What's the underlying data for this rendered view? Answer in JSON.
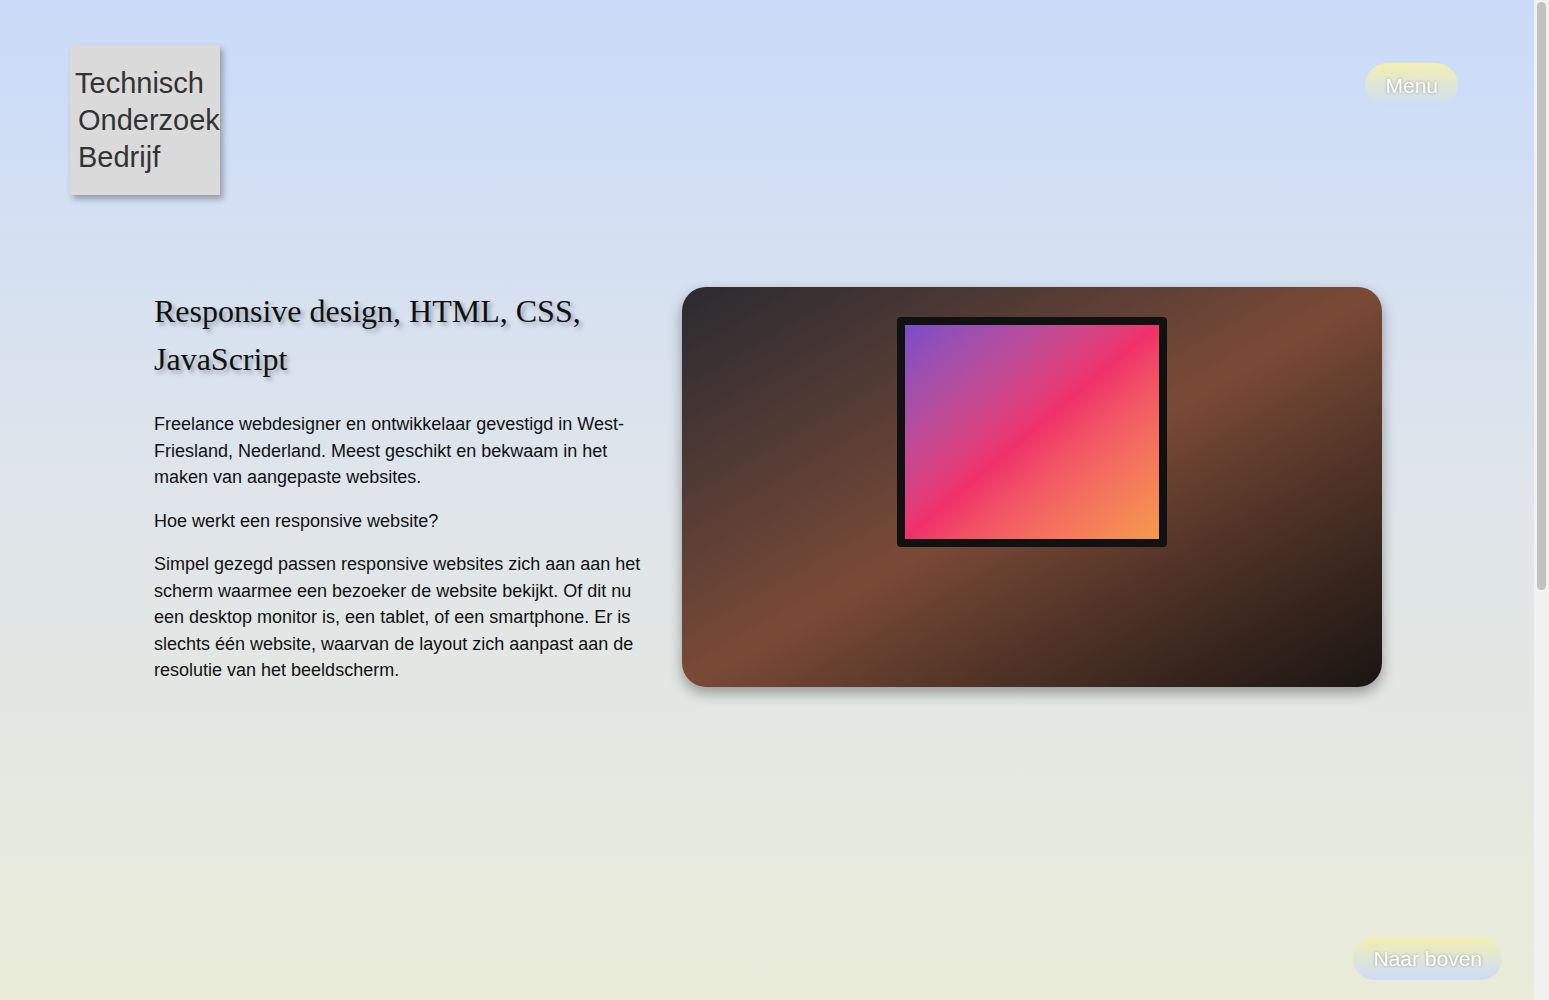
{
  "logo": {
    "lines": [
      "Technisch",
      "Onderzoek",
      "Bedrijf"
    ]
  },
  "menu_button": "Menu",
  "hero": {
    "heading": "Responsive design, HTML, CSS, JavaScript",
    "paragraphs": [
      "Freelance webdesigner en ontwikkelaar gevestigd in West-Friesland, Nederland. Meest geschikt en bekwaam in het maken van aangepaste websites.",
      "Hoe werkt een responsive website?",
      "Simpel gezegd passen responsive websites zich aan aan het scherm waarmee een bezoeker de website bekijkt. Of dit nu een desktop monitor is, een tablet, of een smartphone. Er is slechts één website, waarvan de layout zich aanpast aan de resolutie van het beeldscherm."
    ]
  },
  "back_to_top": "Naar boven"
}
